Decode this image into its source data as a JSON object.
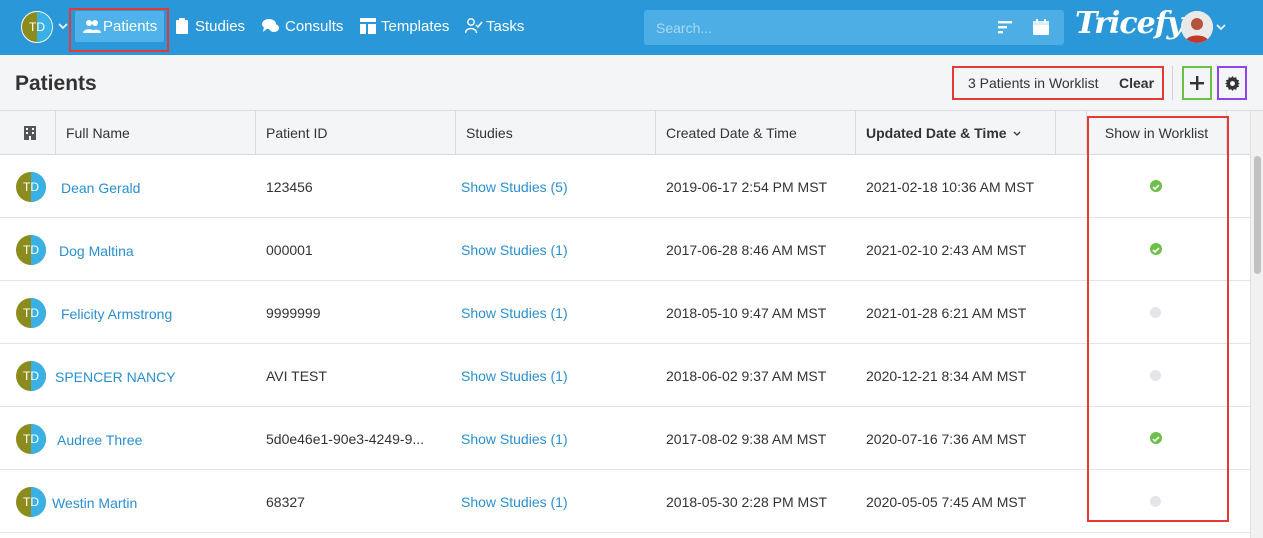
{
  "header": {
    "user_initials": "TD",
    "nav": {
      "patients": "Patients",
      "studies": "Studies",
      "consults": "Consults",
      "templates": "Templates",
      "tasks": "Tasks"
    },
    "search_placeholder": "Search...",
    "brand": "Tricefy"
  },
  "subheader": {
    "title": "Patients",
    "worklist_count": "3 Patients in Worklist",
    "clear_label": "Clear"
  },
  "table": {
    "columns": {
      "full_name": "Full Name",
      "patient_id": "Patient ID",
      "studies": "Studies",
      "created": "Created Date & Time",
      "updated": "Updated Date & Time",
      "worklist": "Show in Worklist"
    },
    "sorted_column": "Updated Date & Time",
    "rows": [
      {
        "initials": "TD",
        "name": "Dean Gerald",
        "patient_id": "123456",
        "studies": "Show Studies (5)",
        "created": "2019-06-17 2:54 PM MST",
        "updated": "2021-02-18 10:36 AM MST",
        "in_worklist": true
      },
      {
        "initials": "TD",
        "name": "Dog Maltina",
        "patient_id": "000001",
        "studies": "Show Studies (1)",
        "created": "2017-06-28 8:46 AM MST",
        "updated": "2021-02-10 2:43 AM MST",
        "in_worklist": true
      },
      {
        "initials": "TD",
        "name": "Felicity Armstrong",
        "patient_id": "9999999",
        "studies": "Show Studies (1)",
        "created": "2018-05-10 9:47 AM MST",
        "updated": "2021-01-28 6:21 AM MST",
        "in_worklist": false
      },
      {
        "initials": "TD",
        "name": "SPENCER NANCY",
        "patient_id": "AVI TEST",
        "studies": "Show Studies (1)",
        "created": "2018-06-02 9:37 AM MST",
        "updated": "2020-12-21 8:34 AM MST",
        "in_worklist": false
      },
      {
        "initials": "TD",
        "name": "Audree  Three",
        "patient_id": "5d0e46e1-90e3-4249-9...",
        "studies": "Show Studies (1)",
        "created": "2017-08-02 9:38 AM MST",
        "updated": "2020-07-16 7:36 AM MST",
        "in_worklist": true
      },
      {
        "initials": "TD",
        "name": "Westin Martin",
        "patient_id": "68327",
        "studies": "Show Studies (1)",
        "created": "2018-05-30 2:28 PM MST",
        "updated": "2020-05-05 7:45 AM MST",
        "in_worklist": false
      }
    ]
  },
  "colors": {
    "nav_bg": "#2a97d9",
    "link": "#2a8fd0",
    "worklist_on": "#6cc04a",
    "highlight_red": "#e53935",
    "highlight_green": "#6cc04a",
    "highlight_purple": "#8e44ec"
  }
}
